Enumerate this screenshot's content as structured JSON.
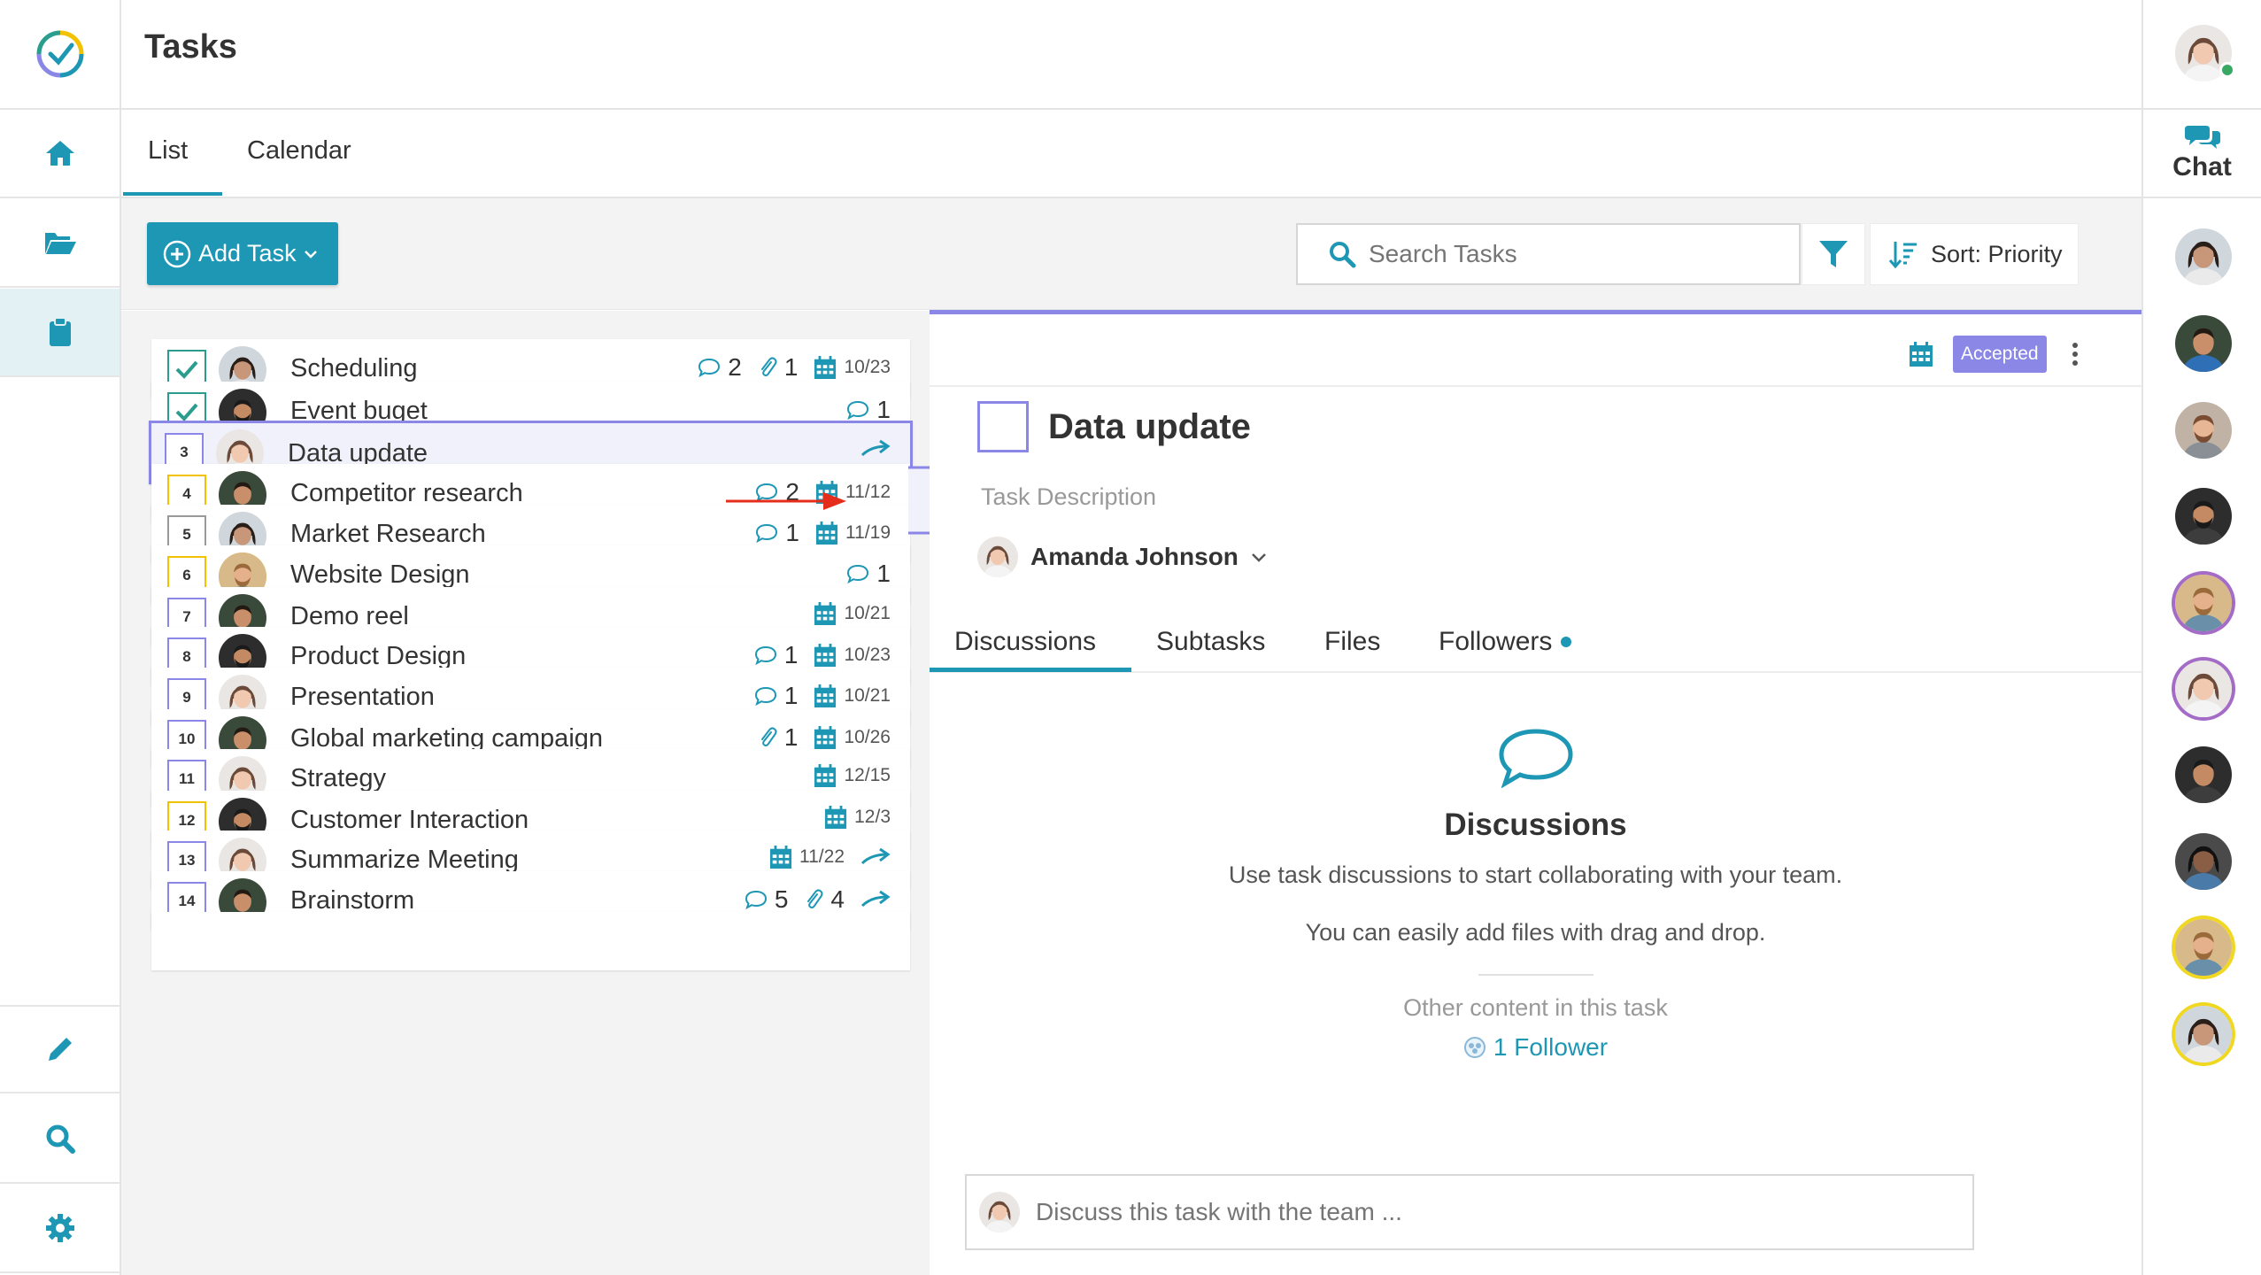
{
  "app": {
    "title": "Tasks"
  },
  "view_tabs": [
    {
      "label": "List"
    },
    {
      "label": "Calendar"
    }
  ],
  "toolbar": {
    "add_task_label": "Add Task",
    "search_placeholder": "Search Tasks",
    "sort_label": "Sort: Priority"
  },
  "chat": {
    "label": "Chat"
  },
  "tasks": [
    {
      "check": "done",
      "number": "",
      "title": "Scheduling",
      "comments": "2",
      "attachments": "1",
      "date": "10/23",
      "box_color": "#2a9d8f"
    },
    {
      "check": "done",
      "number": "",
      "title": "Event buget",
      "comments": "1",
      "attachments": "",
      "date": "",
      "box_color": "#2a9d8f"
    },
    {
      "check": "number",
      "number": "3",
      "title": "Data update",
      "comments": "",
      "attachments": "",
      "date": "",
      "box_color": "#8a87e6"
    },
    {
      "check": "number",
      "number": "4",
      "title": "Competitor research",
      "comments": "2",
      "attachments": "",
      "date": "11/12",
      "box_color": "#f2c200"
    },
    {
      "check": "number",
      "number": "5",
      "title": "Market Research",
      "comments": "1",
      "attachments": "",
      "date": "11/19",
      "box_color": "#999999"
    },
    {
      "check": "number",
      "number": "6",
      "title": "Website Design",
      "comments": "1",
      "attachments": "",
      "date": "",
      "box_color": "#f2c200"
    },
    {
      "check": "number",
      "number": "7",
      "title": "Demo reel",
      "comments": "",
      "attachments": "",
      "date": "10/21",
      "box_color": "#8a87e6"
    },
    {
      "check": "number",
      "number": "8",
      "title": "Product Design",
      "comments": "1",
      "attachments": "",
      "date": "10/23",
      "box_color": "#8a87e6"
    },
    {
      "check": "number",
      "number": "9",
      "title": "Presentation",
      "comments": "1",
      "attachments": "",
      "date": "10/21",
      "box_color": "#8a87e6"
    },
    {
      "check": "number",
      "number": "10",
      "title": "Global marketing campaign",
      "comments": "",
      "attachments": "1",
      "date": "10/26",
      "box_color": "#8a87e6"
    },
    {
      "check": "number",
      "number": "11",
      "title": "Strategy",
      "comments": "",
      "attachments": "",
      "date": "12/15",
      "box_color": "#8a87e6"
    },
    {
      "check": "number",
      "number": "12",
      "title": "Customer Interaction",
      "comments": "",
      "attachments": "",
      "date": "12/3",
      "box_color": "#f2c200"
    },
    {
      "check": "number",
      "number": "13",
      "title": "Summarize Meeting",
      "comments": "",
      "attachments": "",
      "date": "11/22",
      "box_color": "#8a87e6"
    },
    {
      "check": "number",
      "number": "14",
      "title": "Brainstorm",
      "comments": "5",
      "attachments": "4",
      "date": "",
      "box_color": "#8a87e6"
    }
  ],
  "detail": {
    "status_badge": "Accepted",
    "title": "Data update",
    "description_placeholder": "Task Description",
    "assignee": "Amanda Johnson",
    "tabs": [
      {
        "label": "Discussions"
      },
      {
        "label": "Subtasks"
      },
      {
        "label": "Files"
      },
      {
        "label": "Followers"
      }
    ],
    "empty_state": {
      "heading": "Discussions",
      "line1": "Use task discussions to start collaborating with your team.",
      "line2": "You can easily add files with drag and drop.",
      "other_content_label": "Other content in this task",
      "follower_link": "1 Follower"
    },
    "comment_placeholder": "Discuss this task with the team ..."
  },
  "colors": {
    "accent": "#1e97b5",
    "selection": "#8a87e6",
    "annotation_arrow": "#e52d1c"
  }
}
